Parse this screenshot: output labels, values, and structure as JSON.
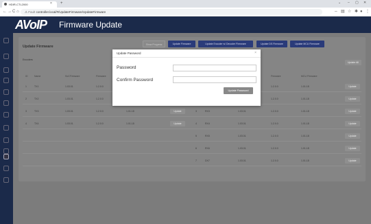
{
  "browser": {
    "tab_title": "HDIR-CTL2000",
    "new_tab": "+",
    "window_controls": [
      "⌄",
      "–",
      "▢",
      "✕"
    ],
    "back": "←",
    "forward": "→",
    "reload": "C",
    "home": "⌂",
    "security_label": "Fault",
    "url": "controller.local/#/UpdateFirmware/UpdateFirmware"
  },
  "header": {
    "logo": "AVoIP",
    "title": "Firmware Update"
  },
  "panel": {
    "title": "Update Firmware",
    "tab_label": "Encoders",
    "actions": [
      "Show Progress",
      "Update Firmware",
      "Update Encoder w/ Decoder Firmware",
      "Update DS Firmware",
      "Update MCU Firmware"
    ],
    "side_button": "Update All",
    "columns_left": [
      "ID",
      "Name",
      "SoCFirmware",
      "Firmware"
    ],
    "columns_right": [
      "Firmware",
      "MCU Firmware"
    ],
    "left_rows": [
      {
        "id": "1",
        "name": "TX1",
        "soc": "1.03.01",
        "fw": "1.2.0.0",
        "mcu": ""
      },
      {
        "id": "2",
        "name": "TX2",
        "soc": "1.03.01",
        "fw": "1.2.0.0",
        "mcu": ""
      },
      {
        "id": "3",
        "name": "TX3",
        "soc": "1.03.01",
        "fw": "1.2.0.0",
        "mcu": "1.01.18"
      },
      {
        "id": "4",
        "name": "TX4",
        "soc": "1.03.01",
        "fw": "1.2.0.0",
        "mcu": "1.01.18"
      }
    ],
    "right_rows": [
      {
        "id": "",
        "name": "",
        "soc": "",
        "fw": "1.2.0.0",
        "mcu": "1.01.18"
      },
      {
        "id": "",
        "name": "",
        "soc": "",
        "fw": "1.2.0.0",
        "mcu": "1.01.18"
      },
      {
        "id": "3",
        "name": "RX3",
        "soc": "1.03.01",
        "fw": "1.2.0.0",
        "mcu": "1.01.18"
      },
      {
        "id": "4",
        "name": "RX4",
        "soc": "1.03.01",
        "fw": "1.2.0.0",
        "mcu": "1.01.18"
      },
      {
        "id": "5",
        "name": "RX5",
        "soc": "1.03.01",
        "fw": "1.2.0.0",
        "mcu": "1.01.18"
      },
      {
        "id": "6",
        "name": "RX6",
        "soc": "1.03.01",
        "fw": "1.2.0.0",
        "mcu": "1.01.18"
      },
      {
        "id": "7",
        "name": "DX7",
        "soc": "1.03.01",
        "fw": "1.2.0.0",
        "mcu": "1.01.18"
      }
    ],
    "row_button": "Update"
  },
  "modal": {
    "title": "Update Password",
    "close": "×",
    "password_label": "Password",
    "confirm_label": "Confirm Password",
    "password_value": "",
    "confirm_value": "",
    "submit": "Update Password"
  }
}
